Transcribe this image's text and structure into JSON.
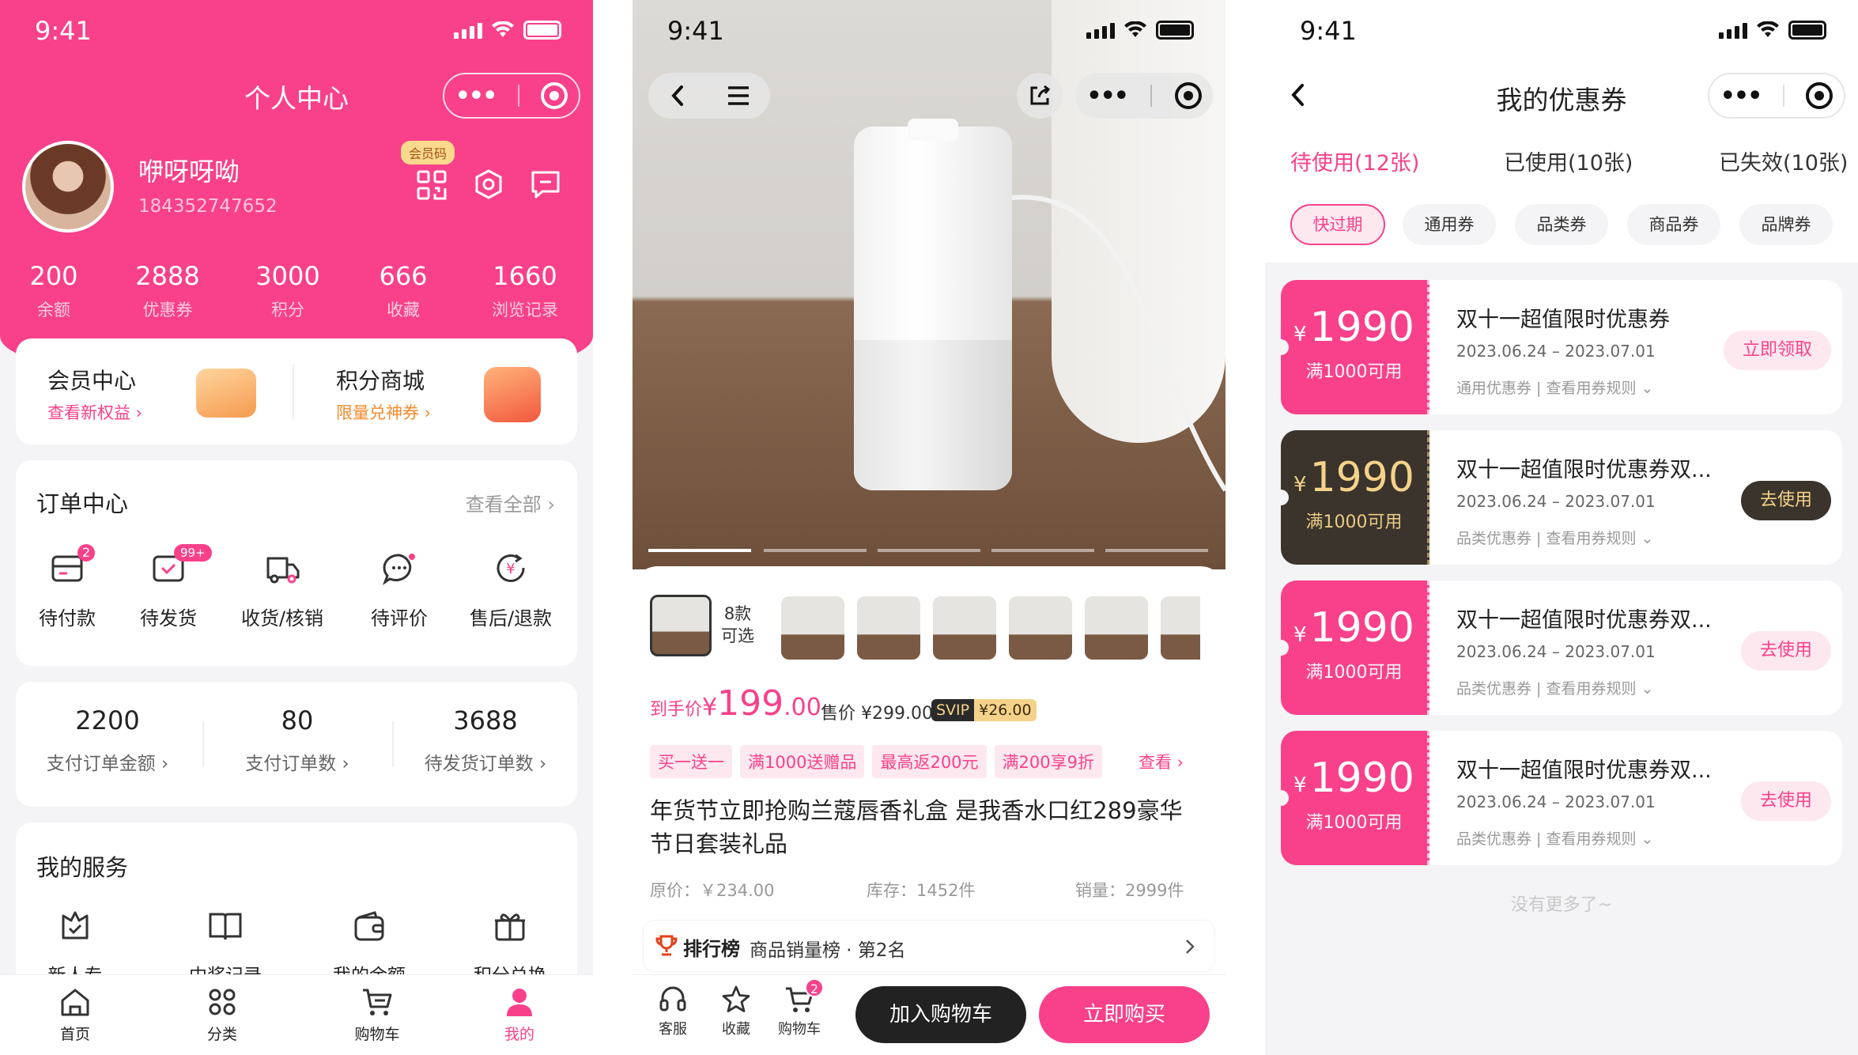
{
  "colors": {
    "brand": "#f8418a",
    "dark": "#3a342c",
    "gold": "#f5d28a",
    "text_gray": "#999999"
  },
  "status": {
    "time": "9:41"
  },
  "profile": {
    "title": "个人中心",
    "username": "咿呀呀呦",
    "user_id": "184352747652",
    "member_badge": "会员码",
    "stats": [
      {
        "value": "200",
        "label": "余额"
      },
      {
        "value": "2888",
        "label": "优惠券"
      },
      {
        "value": "3000",
        "label": "积分"
      },
      {
        "value": "666",
        "label": "收藏"
      },
      {
        "value": "1660",
        "label": "浏览记录"
      }
    ],
    "member_center": {
      "title": "会员中心",
      "link": "查看新权益"
    },
    "points_mall": {
      "title": "积分商城",
      "link": "限量兑神券"
    },
    "orders": {
      "title": "订单中心",
      "view_all": "查看全部",
      "items": [
        {
          "label": "待付款",
          "badge": "2",
          "icon": "wallet-icon"
        },
        {
          "label": "待发货",
          "badge": "99+",
          "icon": "box-icon"
        },
        {
          "label": "收货/核销",
          "badge": "",
          "icon": "truck-icon"
        },
        {
          "label": "待评价",
          "badge": "",
          "icon": "comment-icon"
        },
        {
          "label": "售后/退款",
          "badge": "",
          "icon": "refund-icon"
        }
      ]
    },
    "order_stats": [
      {
        "value": "2200",
        "label": "支付订单金额"
      },
      {
        "value": "80",
        "label": "支付订单数"
      },
      {
        "value": "3688",
        "label": "待发货订单数"
      }
    ],
    "services": {
      "title": "我的服务",
      "items": [
        "新人专享",
        "中奖记录",
        "我的余额",
        "积分兑换"
      ]
    },
    "tabbar": [
      {
        "label": "首页",
        "icon": "home-icon"
      },
      {
        "label": "分类",
        "icon": "grid-icon"
      },
      {
        "label": "购物车",
        "icon": "cart-icon"
      },
      {
        "label": "我的",
        "icon": "user-icon"
      }
    ]
  },
  "product": {
    "variants": {
      "count": "8款",
      "label": "可选"
    },
    "price_prefix": "到手价",
    "price_currency": "¥",
    "price_int": "199",
    "price_dec": ".00",
    "sale_price": "售价 ¥299.00",
    "svip_label": "SVIP",
    "svip_price": "¥26.00",
    "tags": [
      "买一送一",
      "满1000送赠品",
      "最高返200元",
      "满200享9折"
    ],
    "tags_more": "查看",
    "title": "年货节立即抢购兰蔻唇香礼盒 是我香水口红289豪华节日套装礼品",
    "original_price": "原价：￥234.00",
    "stock": "库存：1452件",
    "sales": "销量：2999件",
    "ranking_label": "排行榜",
    "ranking_text": "商品销量榜 · 第2名",
    "bottom_actions": [
      {
        "label": "客服",
        "icon": "headset-icon"
      },
      {
        "label": "收藏",
        "icon": "star-icon"
      },
      {
        "label": "购物车",
        "icon": "cart-icon",
        "badge": "2"
      }
    ],
    "add_cart": "加入购物车",
    "buy_now": "立即购买"
  },
  "coupons": {
    "title": "我的优惠券",
    "tabs": [
      "待使用(12张)",
      "已使用(10张)",
      "已失效(10张)"
    ],
    "filters": [
      "快过期",
      "通用券",
      "品类券",
      "商品券",
      "品牌券"
    ],
    "items": [
      {
        "currency": "¥",
        "amount": "1990",
        "cond": "满1000可用",
        "title": "双十一超值限时优惠券",
        "date": "2023.06.24 – 2023.07.01",
        "type": "通用优惠券",
        "rule": "查看用券规则",
        "btn": "立即领取",
        "style": "pink"
      },
      {
        "currency": "¥",
        "amount": "1990",
        "cond": "满1000可用",
        "title": "双十一超值限时优惠券双...",
        "date": "2023.06.24 – 2023.07.01",
        "type": "品类优惠券",
        "rule": "查看用券规则",
        "btn": "去使用",
        "style": "dark"
      },
      {
        "currency": "¥",
        "amount": "1990",
        "cond": "满1000可用",
        "title": "双十一超值限时优惠券双...",
        "date": "2023.06.24 – 2023.07.01",
        "type": "品类优惠券",
        "rule": "查看用券规则",
        "btn": "去使用",
        "style": "pink"
      },
      {
        "currency": "¥",
        "amount": "1990",
        "cond": "满1000可用",
        "title": "双十一超值限时优惠券双...",
        "date": "2023.06.24 – 2023.07.01",
        "type": "品类优惠券",
        "rule": "查看用券规则",
        "btn": "去使用",
        "style": "pink"
      }
    ],
    "no_more": "没有更多了~"
  }
}
